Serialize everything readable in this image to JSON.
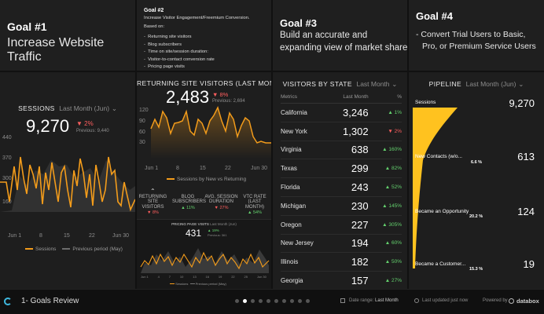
{
  "goal1": {
    "title": "Goal #1",
    "text": "Increase Website Traffic"
  },
  "goal2": {
    "title": "Goal #2",
    "intro": "Increase Visitor Engagement/Freemium Conversion.",
    "based_on": "Based on:",
    "items": [
      "Returning site visitors",
      "Blog subscribers",
      "Time on site/session duration:",
      "Visitor-to-contact conversion rate",
      "Pricing page visits"
    ]
  },
  "goal3": {
    "title": "Goal #3",
    "line1": "Build an accurate and",
    "line2": "expanding view of market share"
  },
  "goal4": {
    "title": "Goal #4",
    "line1": "-  Convert Trial Users to Basic,",
    "line2": "Pro, or Premium Service Users"
  },
  "sessions": {
    "title": "SESSIONS",
    "range": "Last Month (Jun)",
    "value": "9,270",
    "change": "▼ 2%",
    "previous": "Previous: 9,440",
    "y_ticks": [
      "440",
      "370",
      "300",
      "230",
      "160"
    ],
    "x_ticks": [
      "Jun 1",
      "8",
      "15",
      "22",
      "Jun 30"
    ],
    "legend_current": "Sessions",
    "legend_previous": "Previous period (May)"
  },
  "returning": {
    "title": "RETURNING SITE VISITORS (LAST MONTH)",
    "value": "2,483",
    "change": "▼ 8%",
    "previous": "Previous: 2,694",
    "y_ticks": [
      "120",
      "90",
      "60",
      "30"
    ],
    "x_ticks": [
      "Jun 1",
      "8",
      "15",
      "22",
      "Jun 30"
    ],
    "legend": "Sessions by New vs Returning",
    "metrics": [
      {
        "name": "RETURNING SITE VISITORS",
        "change": "▼ 8%",
        "dir": "down"
      },
      {
        "name": "BLOG SUBSCRIBERS",
        "change": "▲ 11%",
        "dir": "up"
      },
      {
        "name": "AVG. SESSION DURATION",
        "change": "▼ 27%",
        "dir": "down"
      },
      {
        "name": "VTC RATE (LAST MONTH)",
        "change": "▲ 54%",
        "dir": "up"
      }
    ]
  },
  "pricing": {
    "title": "PRICING PAGE VISITS",
    "range": "Last Month (Jun)",
    "value": "431",
    "change": "▲ 19%",
    "previous": "Previous: 361",
    "x_ticks": [
      "Jun 1",
      "4",
      "7",
      "10",
      "13",
      "16",
      "19",
      "22",
      "25",
      "Jun 30"
    ],
    "legend_current": "Sessions",
    "legend_previous": "Previous period (May)"
  },
  "visitors_by_state": {
    "title": "VISITORS BY STATE",
    "range": "Last Month",
    "col_metrics": "Metrics",
    "col_month": "Last Month",
    "col_pct": "%",
    "rows": [
      {
        "state": "California",
        "value": "3,246",
        "change": "▲ 1%",
        "dir": "up"
      },
      {
        "state": "New York",
        "value": "1,302",
        "change": "▼ 2%",
        "dir": "down"
      },
      {
        "state": "Virginia",
        "value": "638",
        "change": "▲ 160%",
        "dir": "up"
      },
      {
        "state": "Texas",
        "value": "299",
        "change": "▲ 82%",
        "dir": "up"
      },
      {
        "state": "Florida",
        "value": "243",
        "change": "▲ 52%",
        "dir": "up"
      },
      {
        "state": "Michigan",
        "value": "230",
        "change": "▲ 145%",
        "dir": "up"
      },
      {
        "state": "Oregon",
        "value": "227",
        "change": "▲ 305%",
        "dir": "up"
      },
      {
        "state": "New Jersey",
        "value": "194",
        "change": "▲ 60%",
        "dir": "up"
      },
      {
        "state": "Illinois",
        "value": "182",
        "change": "▲ 50%",
        "dir": "up"
      },
      {
        "state": "Georgia",
        "value": "157",
        "change": "▲ 27%",
        "dir": "up"
      }
    ]
  },
  "pipeline": {
    "title": "PIPELINE",
    "range": "Last Month (Jun)",
    "stages": [
      {
        "label": "Sessions",
        "value": "9,270",
        "pct": ""
      },
      {
        "label": "New Contacts (w/o...",
        "value": "613",
        "pct": "6.6 %"
      },
      {
        "label": "Became an Opportunity",
        "value": "124",
        "pct": "20.2 %"
      },
      {
        "label": "Became a Customer...",
        "value": "19",
        "pct": "15.3 %"
      }
    ]
  },
  "footer": {
    "dashboard_name": "1- Goals Review",
    "date_range_label": "Date range:",
    "date_range_value": "Last Month",
    "last_updated": "Last updated just now",
    "powered_by": "Powered by",
    "brand": "databox",
    "pages": 10,
    "active_page": 1
  },
  "colors": {
    "accent": "#f39c1b",
    "funnel": "#ffc21f",
    "up": "#64d26e",
    "down": "#ff5f5f"
  }
}
